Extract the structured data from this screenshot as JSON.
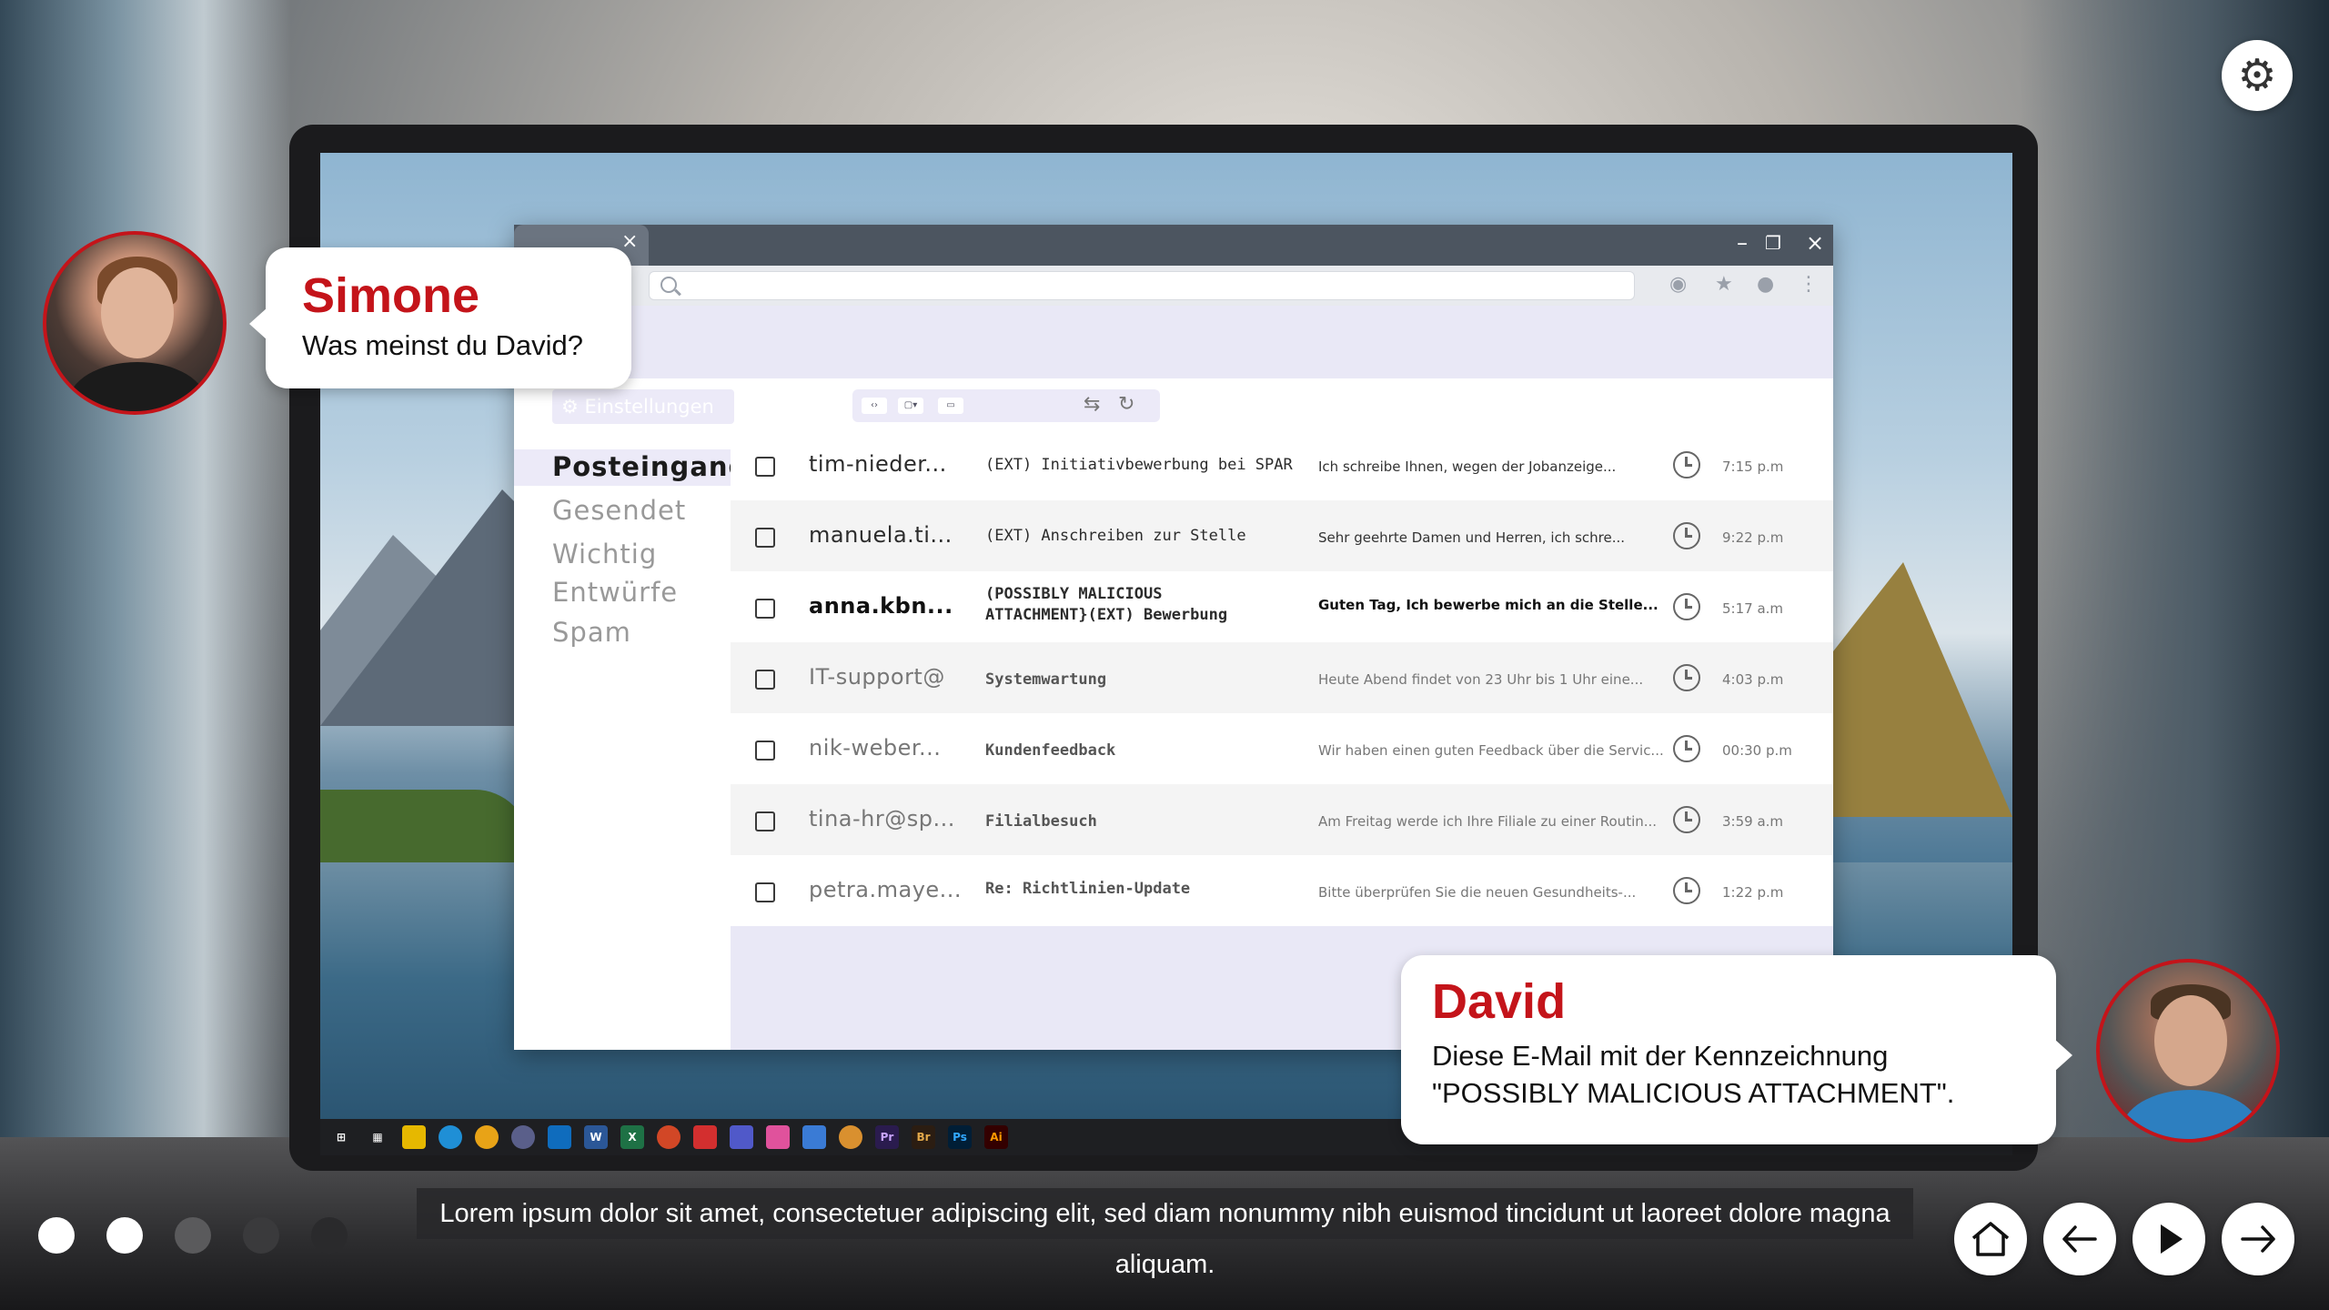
{
  "browser": {
    "folders": [
      "Posteingang",
      "Gesendet",
      "Wichtig",
      "Entwürfe",
      "Spam"
    ],
    "settings_label": "Einstellungen",
    "emails": [
      {
        "sender": "tim-nieder...",
        "subject": "(EXT) Initiativbewerbung bei SPAR",
        "preview": "Ich schreibe Ihnen, wegen der Jobanzeige...",
        "time": "7:15 p.m"
      },
      {
        "sender": "manuela.ti...",
        "subject": "(EXT) Anschreiben zur Stelle",
        "preview": "Sehr geehrte Damen und Herren, ich schre...",
        "time": "9:22 p.m"
      },
      {
        "sender": "anna.kbn...",
        "subject_line1": "(POSSIBLY MALICIOUS",
        "subject_line2": "ATTACHMENT}(EXT) Bewerbung",
        "preview": "Guten Tag, Ich bewerbe mich an die Stelle...",
        "time": "5:17 a.m"
      },
      {
        "sender": "IT-support@",
        "subject": "Systemwartung",
        "preview": "Heute Abend findet von 23 Uhr bis 1 Uhr eine...",
        "time": "4:03 p.m"
      },
      {
        "sender": "nik-weber...",
        "subject": "Kundenfeedback",
        "preview": "Wir haben einen guten Feedback über die Servic...",
        "time": "00:30 p.m"
      },
      {
        "sender": "tina-hr@sp...",
        "subject": "Filialbesuch",
        "preview": "Am Freitag werde ich Ihre Filiale zu einer Routin...",
        "time": "3:59 a.m"
      },
      {
        "sender": "petra.maye...",
        "subject": "Re: Richtlinien-Update",
        "preview": "Bitte überprüfen Sie die neuen Gesundheits-...",
        "time": "1:22 p.m"
      }
    ]
  },
  "simone": {
    "name": "Simone",
    "text": "Was meinst du David?"
  },
  "david": {
    "name": "David",
    "text": "Diese E-Mail mit der Kennzeichnung \"POSSIBLY MALICIOUS ATTACHMENT\"."
  },
  "caption": "Lorem ipsum dolor sit amet, consectetuer adipiscing elit, sed diam nonummy nibh euismod tincidunt ut laoreet dolore magna aliquam.",
  "colors": {
    "accent": "#c4141a",
    "mail_pane": "#e9e8f6"
  }
}
